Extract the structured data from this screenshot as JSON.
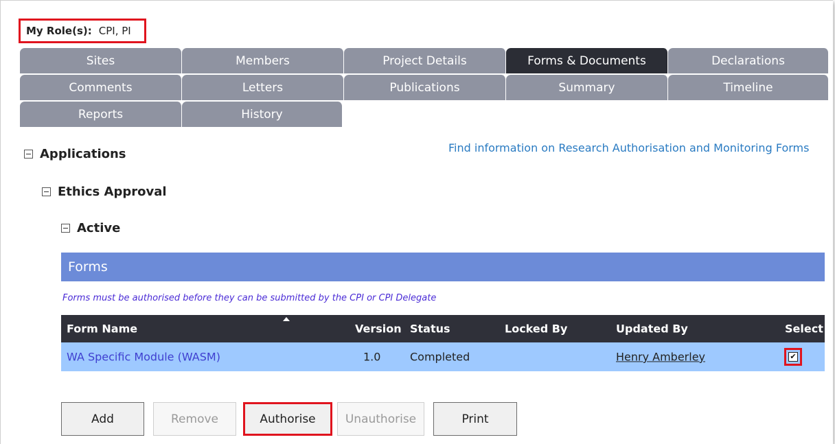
{
  "roles": {
    "label": "My Role(s):",
    "value": "CPI, PI"
  },
  "tabs": [
    "Sites",
    "Members",
    "Project Details",
    "Forms & Documents",
    "Declarations",
    "Comments",
    "Letters",
    "Publications",
    "Summary",
    "Timeline",
    "Reports",
    "History"
  ],
  "active_tab": "Forms & Documents",
  "info_link": "Find information on Research Authorisation and Monitoring Forms",
  "tree": {
    "applications": "Applications",
    "ethics_approval": "Ethics Approval",
    "active": "Active"
  },
  "forms": {
    "title": "Forms",
    "notice": "Forms must be authorised before they can be submitted by the CPI or CPI Delegate",
    "columns": {
      "form_name": "Form Name",
      "version": "Version",
      "status": "Status",
      "locked_by": "Locked By",
      "updated_by": "Updated By",
      "select": "Select"
    },
    "rows": [
      {
        "form_name": "WA Specific Module (WASM)",
        "version": "1.0",
        "status": "Completed",
        "locked_by": "",
        "updated_by": "Henry Amberley",
        "selected": true
      }
    ]
  },
  "buttons": {
    "add": "Add",
    "remove": "Remove",
    "authorise": "Authorise",
    "unauthorise": "Unauthorise",
    "print": "Print"
  },
  "colors": {
    "tab_inactive": "#8f93a1",
    "tab_active": "#2b2d35",
    "forms_header": "#6c8bd8",
    "table_header": "#2f3039",
    "selected_row": "#9ec9ff",
    "highlight": "#e0141e",
    "link": "#2a7bc2"
  }
}
